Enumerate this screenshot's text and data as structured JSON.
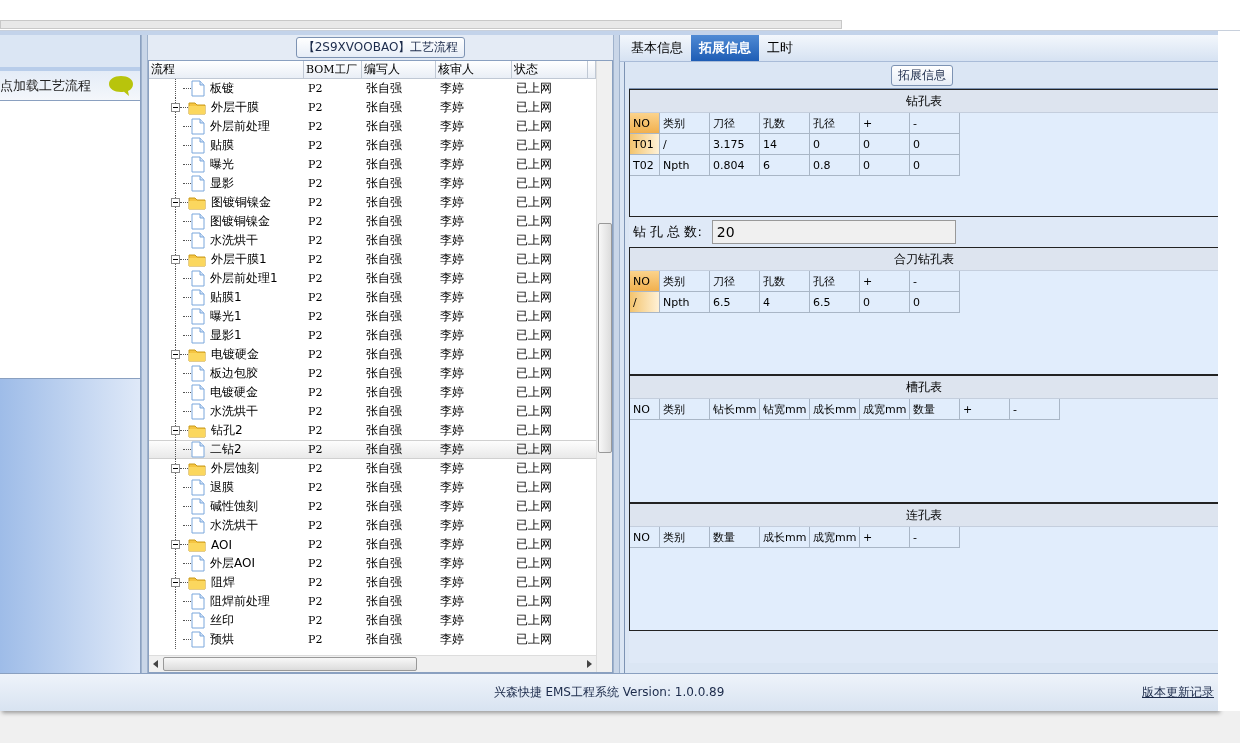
{
  "left_panel": {
    "hint": "点加载工艺流程"
  },
  "flow_group": {
    "title": "【2S9XVOOBAO】工艺流程"
  },
  "tree": {
    "columns": [
      "流程",
      "BOM工厂",
      "编写人",
      "核审人",
      "状态"
    ],
    "items": [
      {
        "kind": "leaf",
        "label": "板镀",
        "bom": "P2",
        "writer": "张自强",
        "reviewer": "李婷",
        "status": "已上网",
        "selected": false
      },
      {
        "kind": "group",
        "label": "外层干膜",
        "bom": "P2",
        "writer": "张自强",
        "reviewer": "李婷",
        "status": "已上网",
        "selected": false,
        "expanded": true,
        "children": [
          {
            "kind": "leaf",
            "label": "外层前处理",
            "bom": "P2",
            "writer": "张自强",
            "reviewer": "李婷",
            "status": "已上网",
            "selected": false
          },
          {
            "kind": "leaf",
            "label": "贴膜",
            "bom": "P2",
            "writer": "张自强",
            "reviewer": "李婷",
            "status": "已上网",
            "selected": false
          },
          {
            "kind": "leaf",
            "label": "曝光",
            "bom": "P2",
            "writer": "张自强",
            "reviewer": "李婷",
            "status": "已上网",
            "selected": false
          },
          {
            "kind": "leaf",
            "label": "显影",
            "bom": "P2",
            "writer": "张自强",
            "reviewer": "李婷",
            "status": "已上网",
            "selected": false
          }
        ]
      },
      {
        "kind": "group",
        "label": "图镀铜镍金",
        "bom": "P2",
        "writer": "张自强",
        "reviewer": "李婷",
        "status": "已上网",
        "selected": false,
        "expanded": true,
        "children": [
          {
            "kind": "leaf",
            "label": "图镀铜镍金",
            "bom": "P2",
            "writer": "张自强",
            "reviewer": "李婷",
            "status": "已上网",
            "selected": false
          },
          {
            "kind": "leaf",
            "label": "水洗烘干",
            "bom": "P2",
            "writer": "张自强",
            "reviewer": "李婷",
            "status": "已上网",
            "selected": false
          }
        ]
      },
      {
        "kind": "group",
        "label": "外层干膜1",
        "bom": "P2",
        "writer": "张自强",
        "reviewer": "李婷",
        "status": "已上网",
        "selected": false,
        "expanded": true,
        "children": [
          {
            "kind": "leaf",
            "label": "外层前处理1",
            "bom": "P2",
            "writer": "张自强",
            "reviewer": "李婷",
            "status": "已上网",
            "selected": false
          },
          {
            "kind": "leaf",
            "label": "贴膜1",
            "bom": "P2",
            "writer": "张自强",
            "reviewer": "李婷",
            "status": "已上网",
            "selected": false
          },
          {
            "kind": "leaf",
            "label": "曝光1",
            "bom": "P2",
            "writer": "张自强",
            "reviewer": "李婷",
            "status": "已上网",
            "selected": false
          },
          {
            "kind": "leaf",
            "label": "显影1",
            "bom": "P2",
            "writer": "张自强",
            "reviewer": "李婷",
            "status": "已上网",
            "selected": false
          }
        ]
      },
      {
        "kind": "group",
        "label": "电镀硬金",
        "bom": "P2",
        "writer": "张自强",
        "reviewer": "李婷",
        "status": "已上网",
        "selected": false,
        "expanded": true,
        "children": [
          {
            "kind": "leaf",
            "label": "板边包胶",
            "bom": "P2",
            "writer": "张自强",
            "reviewer": "李婷",
            "status": "已上网",
            "selected": false
          },
          {
            "kind": "leaf",
            "label": "电镀硬金",
            "bom": "P2",
            "writer": "张自强",
            "reviewer": "李婷",
            "status": "已上网",
            "selected": false
          },
          {
            "kind": "leaf",
            "label": "水洗烘干",
            "bom": "P2",
            "writer": "张自强",
            "reviewer": "李婷",
            "status": "已上网",
            "selected": false
          }
        ]
      },
      {
        "kind": "group",
        "label": "钻孔2",
        "bom": "P2",
        "writer": "张自强",
        "reviewer": "李婷",
        "status": "已上网",
        "selected": false,
        "expanded": true,
        "children": [
          {
            "kind": "leaf",
            "label": "二钻2",
            "bom": "P2",
            "writer": "张自强",
            "reviewer": "李婷",
            "status": "已上网",
            "selected": true
          }
        ]
      },
      {
        "kind": "group",
        "label": "外层蚀刻",
        "bom": "P2",
        "writer": "张自强",
        "reviewer": "李婷",
        "status": "已上网",
        "selected": false,
        "expanded": true,
        "children": [
          {
            "kind": "leaf",
            "label": "退膜",
            "bom": "P2",
            "writer": "张自强",
            "reviewer": "李婷",
            "status": "已上网",
            "selected": false
          },
          {
            "kind": "leaf",
            "label": "碱性蚀刻",
            "bom": "P2",
            "writer": "张自强",
            "reviewer": "李婷",
            "status": "已上网",
            "selected": false
          },
          {
            "kind": "leaf",
            "label": "水洗烘干",
            "bom": "P2",
            "writer": "张自强",
            "reviewer": "李婷",
            "status": "已上网",
            "selected": false
          }
        ]
      },
      {
        "kind": "group",
        "label": "AOI",
        "bom": "P2",
        "writer": "张自强",
        "reviewer": "李婷",
        "status": "已上网",
        "selected": false,
        "expanded": true,
        "children": [
          {
            "kind": "leaf",
            "label": "外层AOI",
            "bom": "P2",
            "writer": "张自强",
            "reviewer": "李婷",
            "status": "已上网",
            "selected": false
          }
        ]
      },
      {
        "kind": "group",
        "label": "阻焊",
        "bom": "P2",
        "writer": "张自强",
        "reviewer": "李婷",
        "status": "已上网",
        "selected": false,
        "expanded": true,
        "children": [
          {
            "kind": "leaf",
            "label": "阻焊前处理",
            "bom": "P2",
            "writer": "张自强",
            "reviewer": "李婷",
            "status": "已上网",
            "selected": false
          },
          {
            "kind": "leaf",
            "label": "丝印",
            "bom": "P2",
            "writer": "张自强",
            "reviewer": "李婷",
            "status": "已上网",
            "selected": false
          },
          {
            "kind": "leaf",
            "label": "预烘",
            "bom": "P2",
            "writer": "张自强",
            "reviewer": "李婷",
            "status": "已上网",
            "selected": false
          }
        ]
      }
    ]
  },
  "tabs": [
    {
      "label": "基本信息",
      "selected": false
    },
    {
      "label": "拓展信息",
      "selected": true
    },
    {
      "label": "工时",
      "selected": false
    }
  ],
  "ext_group": {
    "title": "拓展信息"
  },
  "sections": [
    {
      "title": "钻孔表",
      "columns": [
        "NO",
        "类别",
        "刀径",
        "孔数",
        "孔径",
        "+",
        "-"
      ],
      "rows": [
        {
          "selected": true,
          "cells": [
            "T01",
            "/",
            "3.175",
            "14",
            "0",
            "0",
            "0"
          ]
        },
        {
          "selected": false,
          "cells": [
            "T02",
            "Npth",
            "0.804",
            "6",
            "0.8",
            "0",
            "0"
          ]
        }
      ],
      "total": {
        "label": "钻 孔 总 数:",
        "value": "20"
      }
    },
    {
      "title": "合刀钻孔表",
      "columns": [
        "NO",
        "类别",
        "刀径",
        "孔数",
        "孔径",
        "+",
        "-"
      ],
      "rows": [
        {
          "selected": true,
          "cells": [
            "/",
            "Npth",
            "6.5",
            "4",
            "6.5",
            "0",
            "0"
          ]
        }
      ]
    },
    {
      "title": "槽孔表",
      "columns": [
        "NO",
        "类别",
        "钻长mm",
        "钻宽mm",
        "成长mm",
        "成宽mm",
        "数量",
        "+",
        "-"
      ]
    },
    {
      "title": "连孔表",
      "columns": [
        "NO",
        "类别",
        "数量",
        "成长mm",
        "成宽mm",
        "+",
        "-"
      ]
    }
  ],
  "status_bar": {
    "text": "兴森快捷 EMS工程系统 Version: 1.0.0.89",
    "link": "版本更新记录"
  }
}
